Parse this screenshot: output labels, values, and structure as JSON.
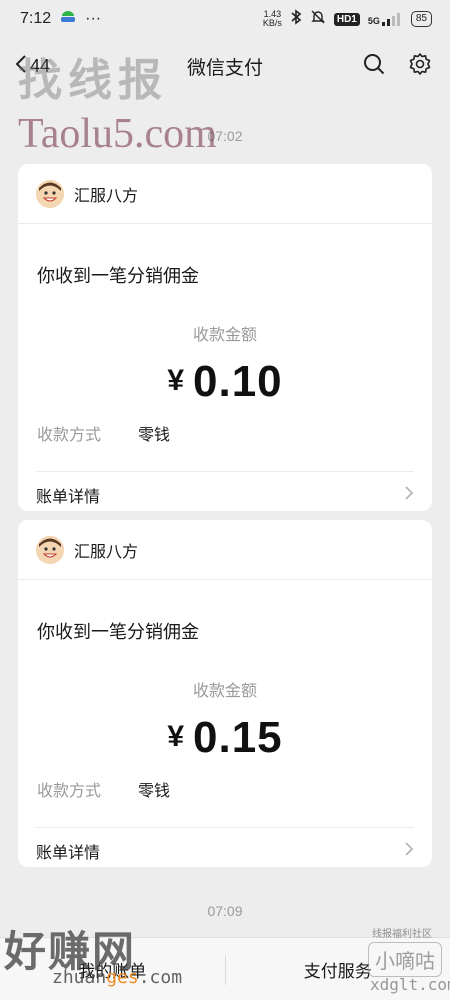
{
  "status_bar": {
    "time": "7:12",
    "dots": "···",
    "speed_value": "1.43",
    "speed_unit": "KB/s",
    "hd_label": "HD1",
    "network_label": "5G",
    "battery": "85"
  },
  "nav": {
    "back_count": "44",
    "title": "微信支付"
  },
  "timestamps": [
    "07:02",
    "07:09"
  ],
  "cards": [
    {
      "merchant": "汇服八方",
      "title": "你收到一笔分销佣金",
      "amount_label": "收款金额",
      "currency": "¥",
      "amount": "0.10",
      "method_label": "收款方式",
      "method_value": "零钱",
      "detail_label": "账单详情"
    },
    {
      "merchant": "汇服八方",
      "title": "你收到一笔分销佣金",
      "amount_label": "收款金额",
      "currency": "¥",
      "amount": "0.15",
      "method_label": "收款方式",
      "method_value": "零钱",
      "detail_label": "账单详情"
    }
  ],
  "bottom_bar": {
    "left_label": "我的账单",
    "right_label": "支付服务"
  },
  "watermarks": {
    "top_cn": "找线报",
    "top_en": "Taolu5.com",
    "bottom_left_cn": "好赚网",
    "bottom_left_en_a": "zhuan",
    "bottom_left_en_b": "ges",
    "bottom_left_en_c": ".com",
    "bottom_right_small": "线报福利社区",
    "bottom_right_cn": "小嘀咕",
    "bottom_right_en": "xdglt.com"
  },
  "icons": {
    "back": "back-chevron-icon",
    "search": "search-icon",
    "settings": "gear-icon",
    "chevron": "chevron-right-icon"
  },
  "colors": {
    "background": "#ededed",
    "card": "#ffffff",
    "secondary_text": "#9a9a9a"
  }
}
